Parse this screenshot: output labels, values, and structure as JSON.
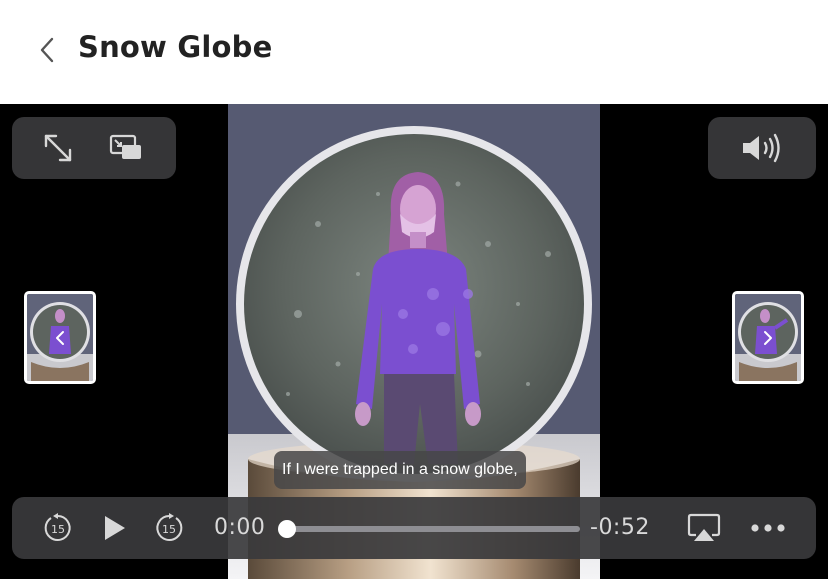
{
  "header": {
    "back_icon": "chevron-left-icon",
    "title": "Snow Globe"
  },
  "top_left_controls": {
    "expand_icon": "expand-arrows-icon",
    "pip_icon": "picture-in-picture-icon"
  },
  "top_right_controls": {
    "volume_icon": "speaker-volume-icon"
  },
  "navigation": {
    "prev_icon": "chevron-left-icon",
    "next_icon": "chevron-right-icon"
  },
  "caption": {
    "text": "If I were trapped in a snow globe,"
  },
  "playback": {
    "skip_back_icon": "skip-back-15-icon",
    "skip_back_seconds": "15",
    "play_icon": "play-icon",
    "skip_forward_icon": "skip-forward-15-icon",
    "skip_forward_seconds": "15",
    "elapsed": "0:00",
    "remaining": "-0:52",
    "progress_fraction": 0,
    "airplay_icon": "airplay-icon",
    "more_icon": "more-ellipsis-icon"
  },
  "colors": {
    "overlay": "#3a3a3c",
    "figure": "#7b4fd0",
    "globe": "#5f6660",
    "background": "#000000"
  }
}
